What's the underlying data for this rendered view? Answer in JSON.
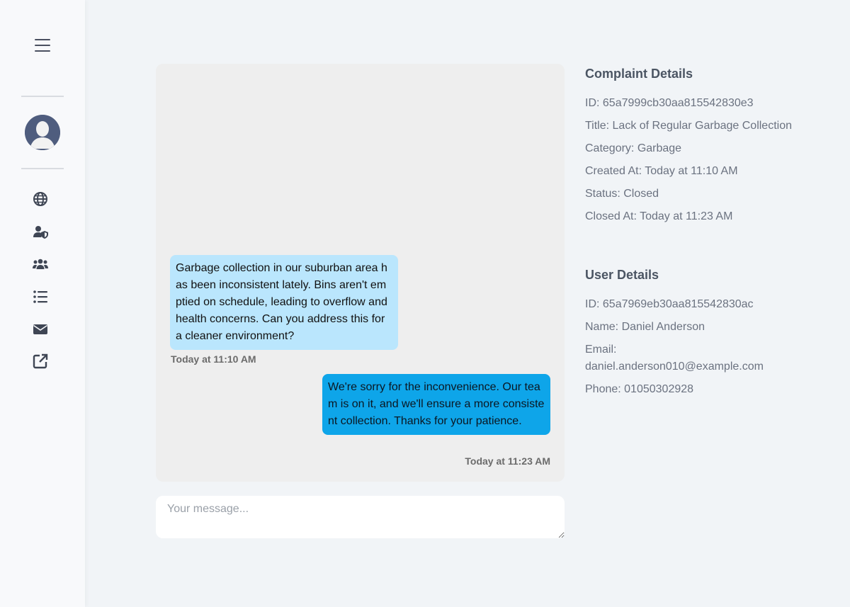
{
  "chat": {
    "messages": [
      {
        "text": "Garbage collection in our suburban area has been inconsistent lately. Bins aren't emptied on schedule, leading to overflow and health concerns. Can you address this for a cleaner environment?",
        "time": "Today at 11:10 AM",
        "direction": "incoming"
      },
      {
        "text": "We're sorry for the inconvenience. Our team is on it, and we'll ensure a more consistent collection. Thanks for your patience.",
        "time": "Today at 11:23 AM",
        "direction": "outgoing"
      }
    ],
    "input_placeholder": "Your message...",
    "input_value": ""
  },
  "complaint": {
    "heading": "Complaint Details",
    "id": "ID: 65a7999cb30aa815542830e3",
    "title": "Title: Lack of Regular Garbage Collection",
    "category": "Category: Garbage",
    "created_at": "Created At: Today at 11:10 AM",
    "status": "Status: Closed",
    "closed_at": "Closed At: Today at 11:23 AM"
  },
  "user": {
    "heading": "User Details",
    "id": "ID: 65a7969eb30aa815542830ac",
    "name": "Name: Daniel Anderson",
    "email_label": "Email:",
    "email": "daniel.anderson010@example.com",
    "phone": "Phone: 01050302928"
  },
  "sidebar": {
    "icons": [
      "menu-icon",
      "user-avatar",
      "globe-icon",
      "user-shield-icon",
      "users-icon",
      "list-icon",
      "envelope-icon",
      "external-link-icon"
    ]
  },
  "colors": {
    "incoming_bubble": "#bae6fd",
    "outgoing_bubble": "#0ea5e9",
    "chat_background": "#eeeeee",
    "page_background": "#f1f4f7"
  }
}
